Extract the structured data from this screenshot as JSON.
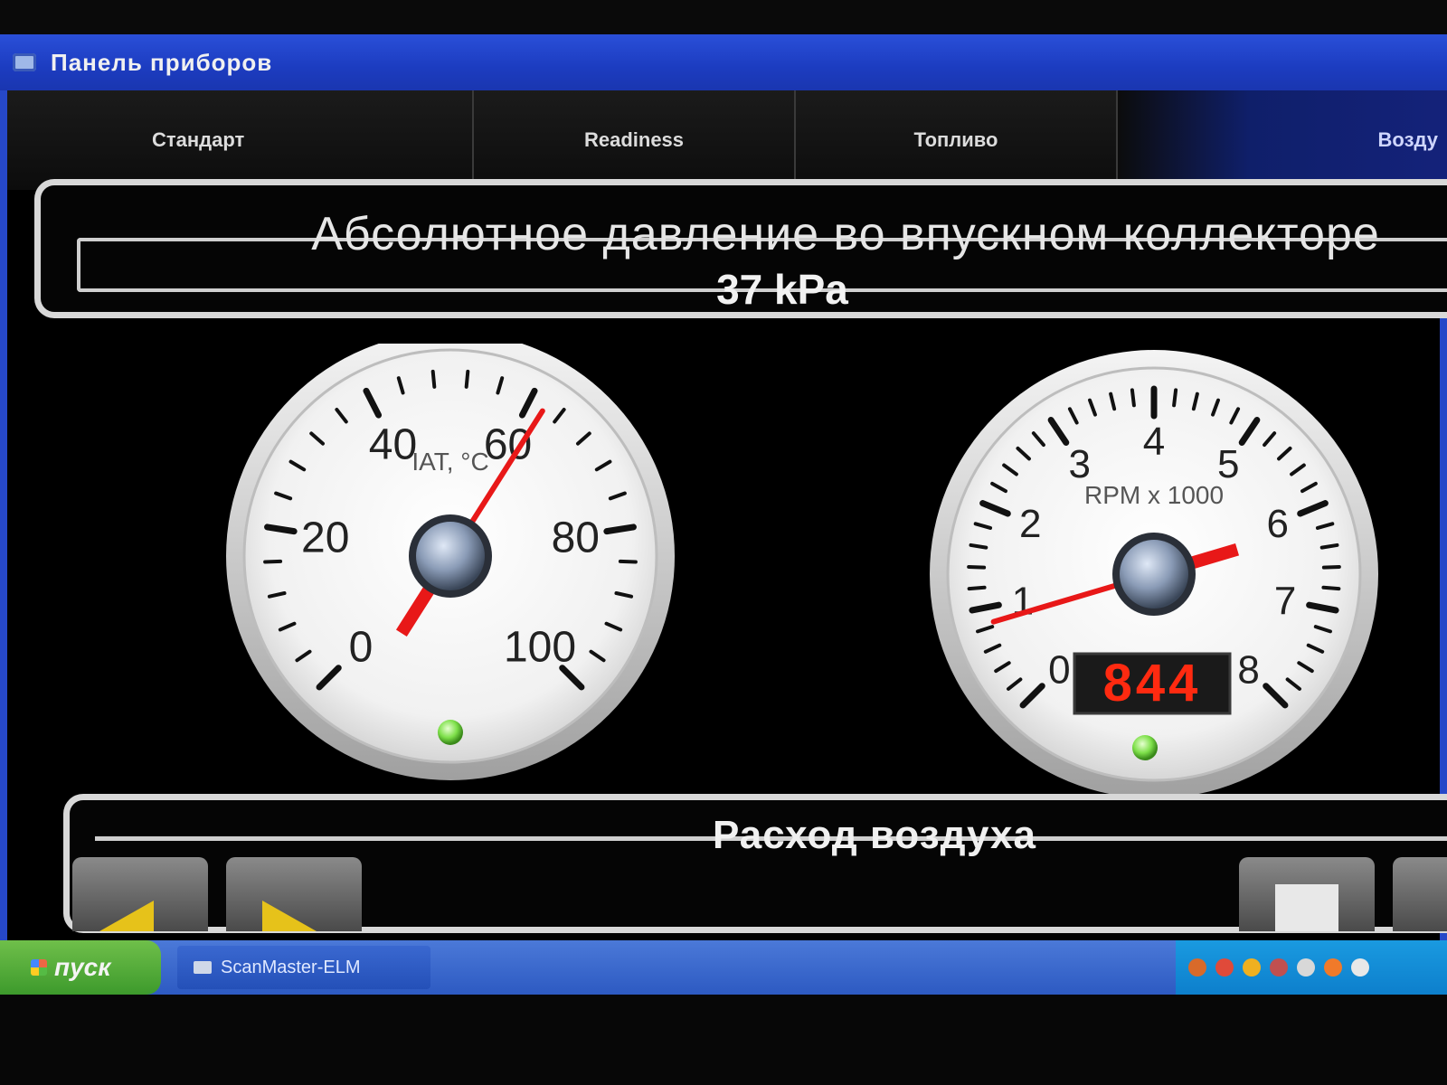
{
  "window": {
    "title": "Панель приборов"
  },
  "tabs": [
    "Стандарт",
    "Readiness",
    "Топливо",
    "Возду"
  ],
  "map_panel": {
    "title": "Абсолютное давление во впускном коллекторе",
    "value": "37 kPa"
  },
  "iat_gauge": {
    "label": "IAT, °C",
    "ticks": [
      "0",
      "20",
      "40",
      "60",
      "80",
      "100"
    ],
    "min": 0,
    "max": 100,
    "reading": 62
  },
  "rpm_gauge": {
    "label": "RPM x 1000",
    "ticks": [
      "0",
      "1",
      "2",
      "3",
      "4",
      "5",
      "6",
      "7",
      "8"
    ],
    "min": 0,
    "max": 8,
    "reading": 0.844,
    "digital": "844"
  },
  "airflow_panel": {
    "title": "Расход воздуха"
  },
  "taskbar": {
    "start_label": "пуск",
    "task_label": "ScanMaster-ELM"
  },
  "colors": {
    "needle": "#e81818",
    "led": "#7ee04a",
    "digital": "#ff2a10",
    "tab_active_accent": "#14227a"
  }
}
